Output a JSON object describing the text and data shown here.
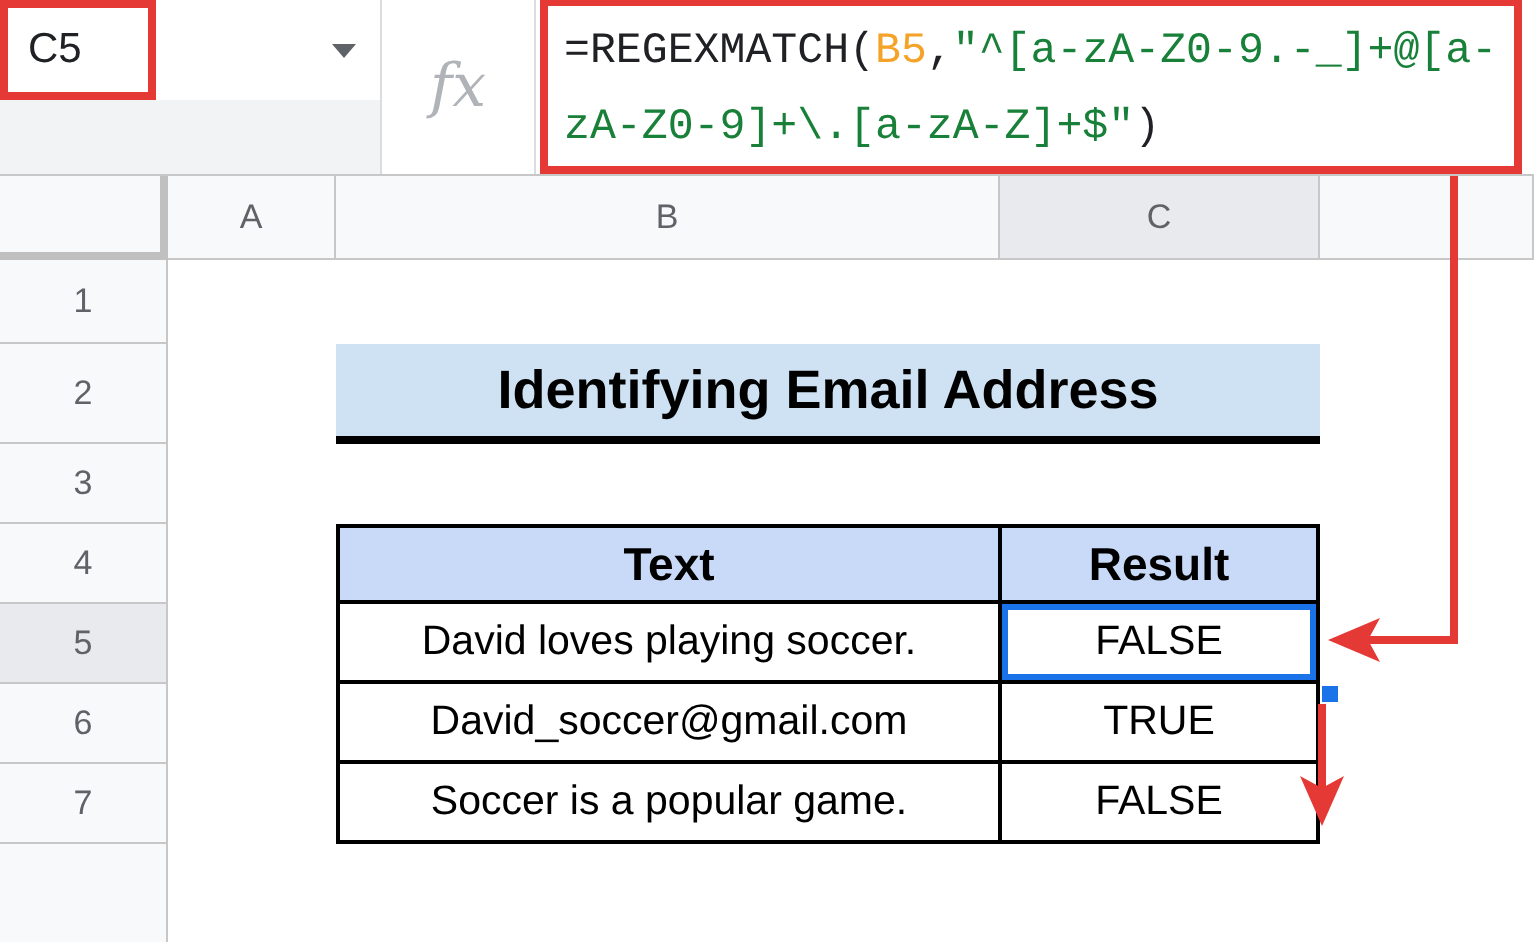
{
  "name_box": "C5",
  "fx": "fx",
  "formula_parts": [
    {
      "kind": "plain",
      "text": "=REGEXMATCH("
    },
    {
      "kind": "ref",
      "text": "B5"
    },
    {
      "kind": "plain",
      "text": ","
    },
    {
      "kind": "string",
      "text": "\"^[a-zA-Z0-9.-_]+@[a-zA-Z0-9]+\\.[a-zA-Z]+$\""
    },
    {
      "kind": "plain",
      "text": ")"
    }
  ],
  "columns": [
    {
      "label": "A",
      "selected": false
    },
    {
      "label": "B",
      "selected": false
    },
    {
      "label": "C",
      "selected": true
    }
  ],
  "rows": [
    {
      "label": "1",
      "selected": false
    },
    {
      "label": "2",
      "selected": false
    },
    {
      "label": "3",
      "selected": false
    },
    {
      "label": "4",
      "selected": false
    },
    {
      "label": "5",
      "selected": true
    },
    {
      "label": "6",
      "selected": false
    },
    {
      "label": "7",
      "selected": false
    }
  ],
  "title": "Identifying Email Address",
  "table": {
    "headers": [
      "Text",
      "Result"
    ],
    "rows": [
      {
        "text": "David loves playing soccer.",
        "result": "FALSE",
        "selected": true
      },
      {
        "text": "David_soccer@gmail.com",
        "result": "TRUE",
        "selected": false
      },
      {
        "text": "Soccer is a popular game.",
        "result": "FALSE",
        "selected": false
      }
    ]
  }
}
